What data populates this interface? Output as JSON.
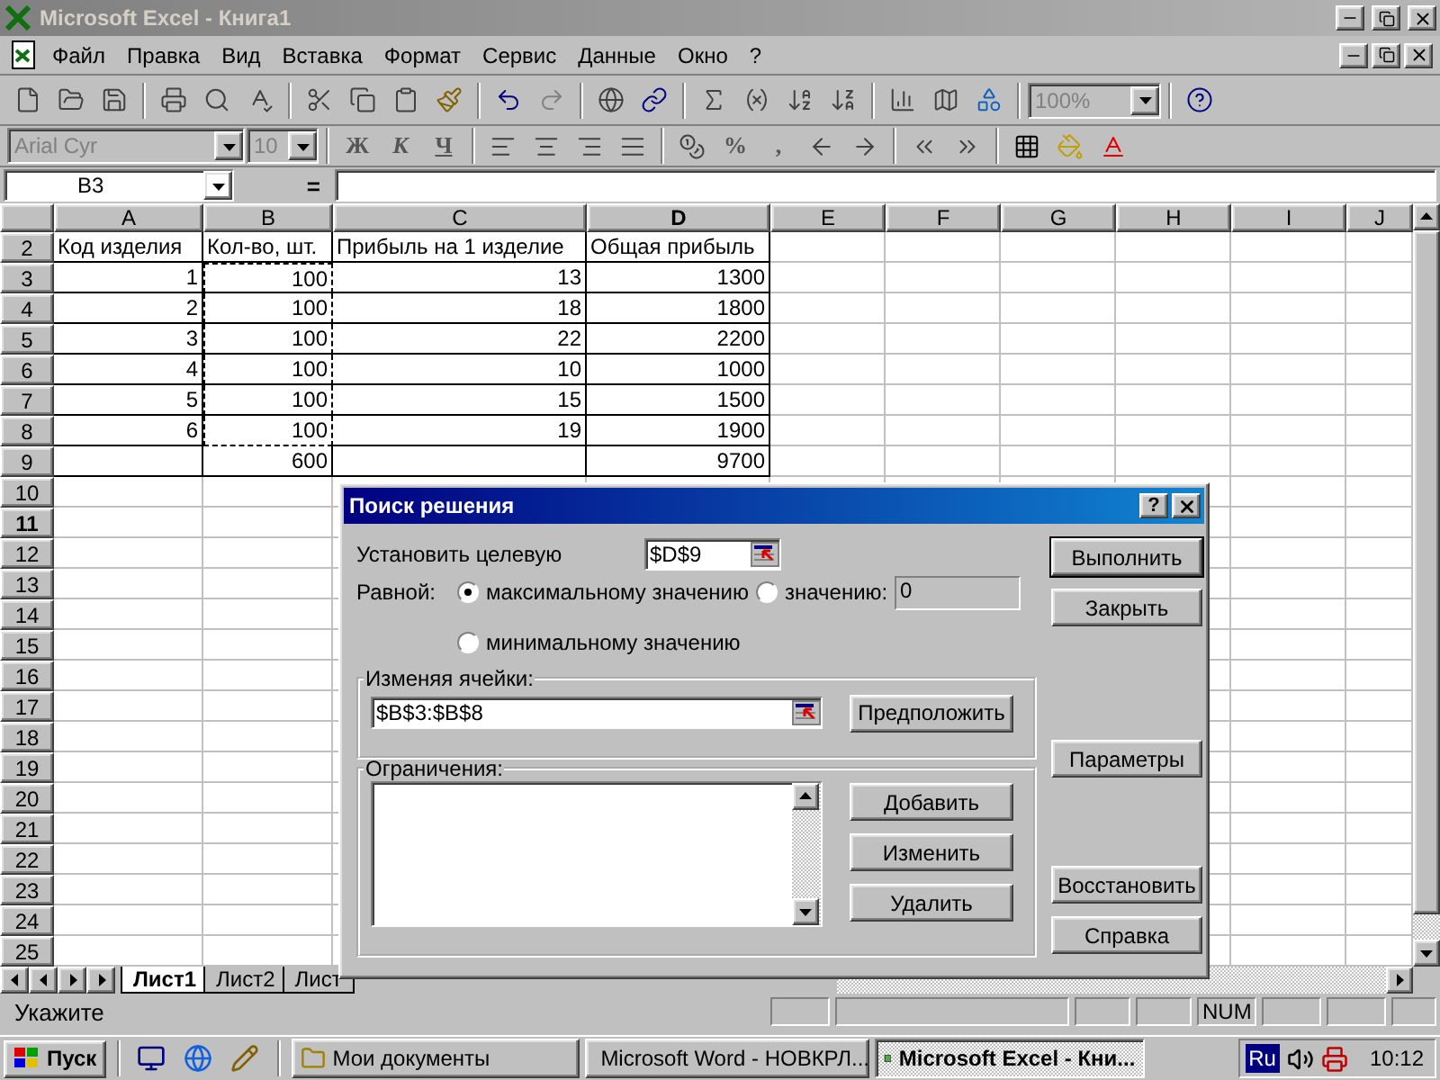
{
  "window": {
    "title": "Microsoft Excel - Книга1"
  },
  "menu": [
    "Файл",
    "Правка",
    "Вид",
    "Вставка",
    "Формат",
    "Сервис",
    "Данные",
    "Окно",
    "?"
  ],
  "toolbar": {
    "zoom": "100%"
  },
  "format_toolbar": {
    "font": "Arial Cyr",
    "size": "10",
    "style_buttons": [
      "Ж",
      "К",
      "Ч"
    ],
    "number_buttons": [
      "%",
      ","
    ]
  },
  "formula_bar": {
    "name_box": "B3",
    "equals": "="
  },
  "sheet": {
    "columns": [
      {
        "label": "A",
        "highlighted": false,
        "marquee": false
      },
      {
        "label": "B",
        "highlighted": false,
        "marquee": true
      },
      {
        "label": "C",
        "highlighted": false,
        "marquee": false
      },
      {
        "label": "D",
        "highlighted": true,
        "marquee": false
      },
      {
        "label": "E",
        "highlighted": false,
        "marquee": false
      },
      {
        "label": "F",
        "highlighted": false,
        "marquee": false
      },
      {
        "label": "G",
        "highlighted": false,
        "marquee": false
      },
      {
        "label": "H",
        "highlighted": false,
        "marquee": false
      },
      {
        "label": "I",
        "highlighted": false,
        "marquee": false
      },
      {
        "label": "J",
        "highlighted": false,
        "marquee": false
      }
    ],
    "rows": [
      {
        "label": "2",
        "highlighted": false,
        "marquee": false,
        "kind": "header",
        "cells": [
          "Код изделия",
          "Кол-во, шт.",
          "Прибыль на 1 изделие",
          "Общая прибыль"
        ]
      },
      {
        "label": "3",
        "highlighted": false,
        "marquee": true,
        "kind": "data",
        "cells": [
          "1",
          "100",
          "13",
          "1300"
        ]
      },
      {
        "label": "4",
        "highlighted": false,
        "marquee": true,
        "kind": "data",
        "cells": [
          "2",
          "100",
          "18",
          "1800"
        ]
      },
      {
        "label": "5",
        "highlighted": false,
        "marquee": true,
        "kind": "data",
        "cells": [
          "3",
          "100",
          "22",
          "2200"
        ]
      },
      {
        "label": "6",
        "highlighted": false,
        "marquee": true,
        "kind": "data",
        "cells": [
          "4",
          "100",
          "10",
          "1000"
        ]
      },
      {
        "label": "7",
        "highlighted": false,
        "marquee": true,
        "kind": "data",
        "cells": [
          "5",
          "100",
          "15",
          "1500"
        ]
      },
      {
        "label": "8",
        "highlighted": false,
        "marquee": true,
        "kind": "data",
        "cells": [
          "6",
          "100",
          "19",
          "1900"
        ]
      },
      {
        "label": "9",
        "highlighted": false,
        "marquee": false,
        "kind": "data",
        "cells": [
          null,
          "600",
          null,
          "9700"
        ]
      },
      {
        "label": "10",
        "highlighted": false,
        "marquee": false
      },
      {
        "label": "11",
        "highlighted": true,
        "marquee": false
      },
      {
        "label": "12",
        "highlighted": false,
        "marquee": false
      },
      {
        "label": "13",
        "highlighted": false,
        "marquee": false
      },
      {
        "label": "14",
        "highlighted": false,
        "marquee": false
      },
      {
        "label": "15",
        "highlighted": false,
        "marquee": false
      },
      {
        "label": "16",
        "highlighted": false,
        "marquee": false
      },
      {
        "label": "17",
        "highlighted": false,
        "marquee": false
      },
      {
        "label": "18",
        "highlighted": false,
        "marquee": false
      },
      {
        "label": "19",
        "highlighted": false,
        "marquee": false
      },
      {
        "label": "20",
        "highlighted": false,
        "marquee": false
      },
      {
        "label": "21",
        "highlighted": false,
        "marquee": false
      },
      {
        "label": "22",
        "highlighted": false,
        "marquee": false
      },
      {
        "label": "23",
        "highlighted": false,
        "marquee": false
      },
      {
        "label": "24",
        "highlighted": false,
        "marquee": false
      },
      {
        "label": "25",
        "highlighted": false,
        "marquee": false
      }
    ]
  },
  "sheet_tabs": [
    {
      "label": "Лист1",
      "selected": true
    },
    {
      "label": "Лист2",
      "selected": false
    },
    {
      "label": "Лист",
      "selected": false
    }
  ],
  "status_bar": {
    "message": "Укажите",
    "indicator": "NUM"
  },
  "dialog": {
    "title": "Поиск решения",
    "help_button": "?",
    "target_label": "Установить целевую",
    "target_value": "$D$9",
    "equal_label": "Равной:",
    "radios": [
      {
        "label": "максимальному значению",
        "selected": true
      },
      {
        "label": "значению:",
        "selected": false
      },
      {
        "label": "минимальному значению",
        "selected": false
      }
    ],
    "value_field": "0",
    "changing_group": "Изменяя ячейки:",
    "changing_value": "$B$3:$B$8",
    "guess_button": "Предположить",
    "constraints_group": "Ограничения:",
    "constraint_buttons": [
      "Добавить",
      "Изменить",
      "Удалить"
    ],
    "side_buttons": [
      {
        "label": "Выполнить",
        "default": true
      },
      {
        "label": "Закрыть",
        "default": false
      },
      {
        "label": "Параметры",
        "default": false
      },
      {
        "label": "Восстановить",
        "default": false
      },
      {
        "label": "Справка",
        "default": false
      }
    ]
  },
  "taskbar": {
    "start": "Пуск",
    "tasks": [
      {
        "label": "Мои документы",
        "selected": false
      },
      {
        "label": "Microsoft Word - НОВКРЛ...",
        "selected": false
      },
      {
        "label": "Microsoft Excel - Кни...",
        "selected": true
      }
    ],
    "language": "Ru",
    "clock": "10:12"
  }
}
